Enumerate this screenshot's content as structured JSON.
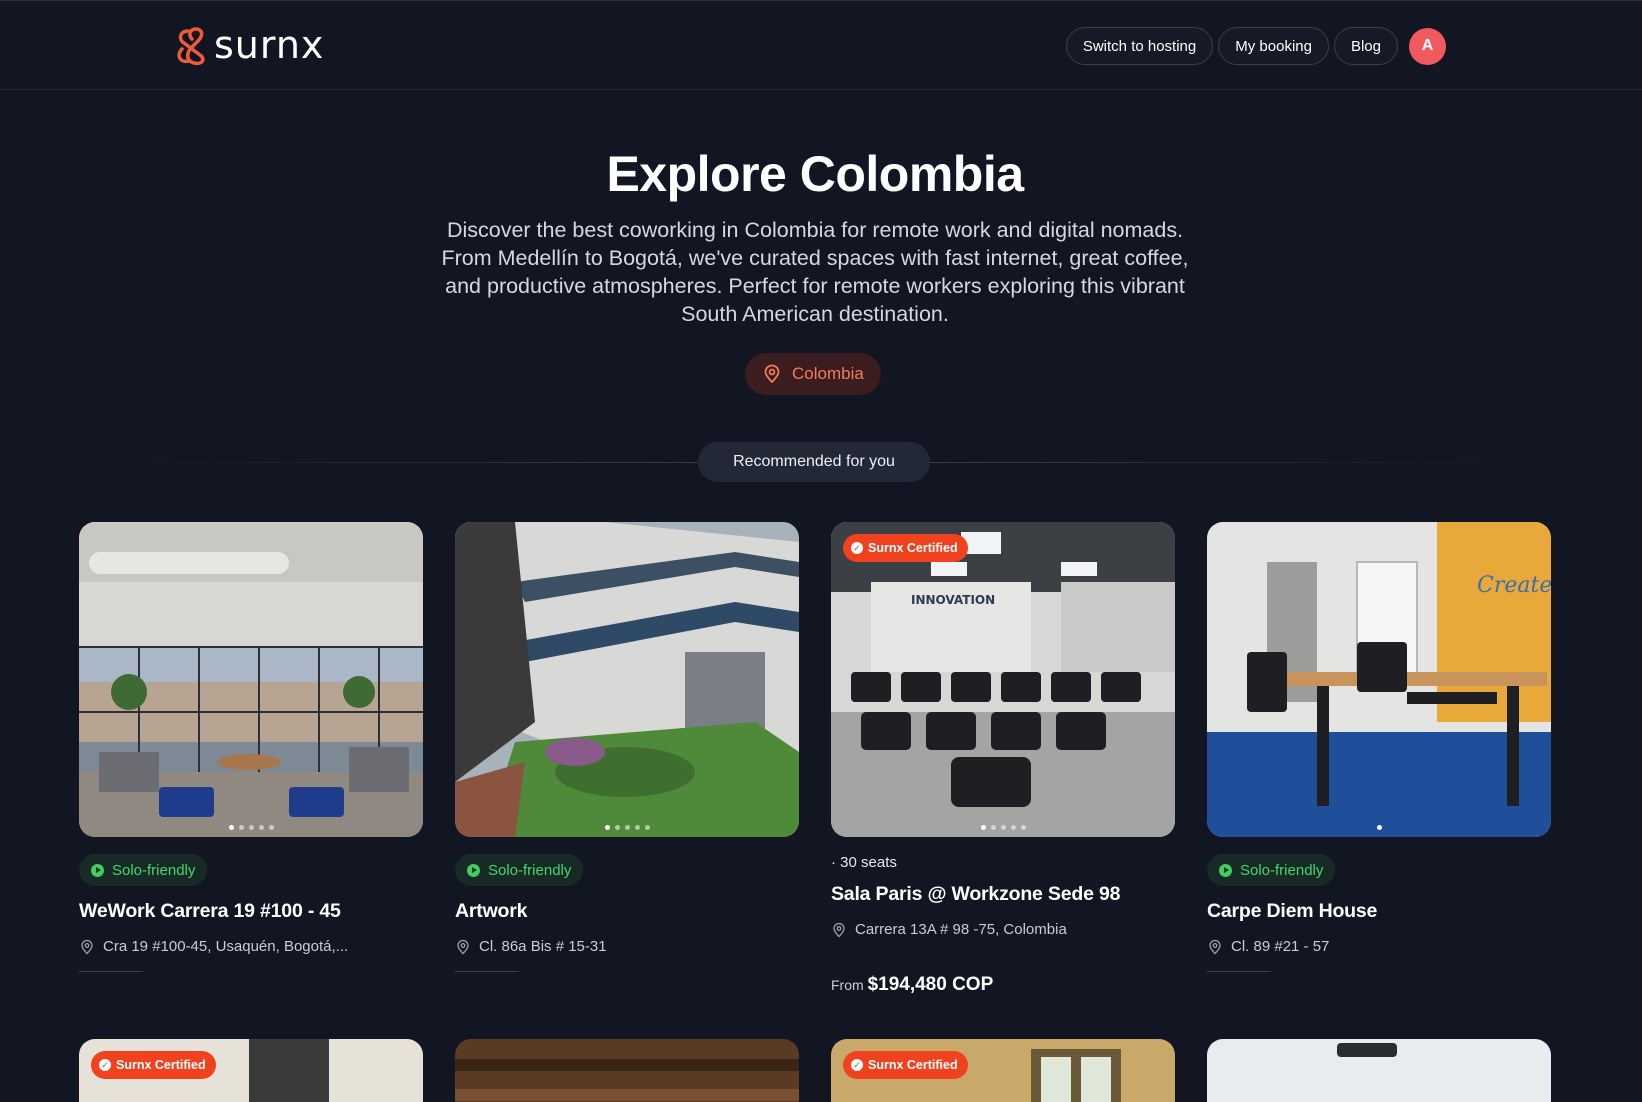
{
  "header": {
    "logo_text": "surnx",
    "nav": {
      "switch_hosting": "Switch to hosting",
      "my_booking": "My booking",
      "blog": "Blog"
    },
    "avatar_initial": "A"
  },
  "hero": {
    "title": "Explore Colombia",
    "description": "Discover the best coworking in Colombia for remote work and digital nomads. From Medellín to Bogotá, we've curated spaces with fast internet, great coffee, and productive atmospheres. Perfect for remote workers exploring this vibrant South American destination.",
    "location_chip": "Colombia"
  },
  "section": {
    "label": "Recommended for you"
  },
  "cards": [
    {
      "solo_label": "Solo-friendly",
      "title": "WeWork Carrera 19 #100 - 45",
      "address": "Cra 19 #100-45, Usaquén, Bogotá,..."
    },
    {
      "solo_label": "Solo-friendly",
      "title": "Artwork",
      "address": "Cl. 86a Bis # 15-31"
    },
    {
      "badge": "Surnx Certified",
      "seats": "· 30 seats",
      "title": "Sala Paris @ Workzone Sede 98",
      "address": "Carrera 13A # 98 -75, Colombia",
      "price_prefix": "From",
      "price": "$194,480 COP"
    },
    {
      "solo_label": "Solo-friendly",
      "title": "Carpe Diem House",
      "address": "Cl. 89 #21 - 57"
    }
  ],
  "row2_badges": {
    "card1": "Surnx Certified",
    "card3": "Surnx Certified"
  },
  "colors": {
    "background": "#121623",
    "accent": "#f0421f",
    "solo_green": "#46d46a",
    "location": "#f37b59"
  }
}
